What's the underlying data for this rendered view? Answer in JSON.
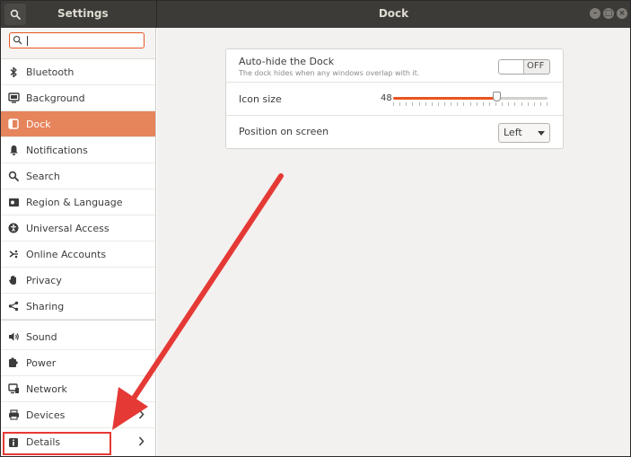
{
  "header": {
    "left_title": "Settings",
    "title": "Dock"
  },
  "search": {
    "value": "",
    "placeholder": ""
  },
  "sidebar": {
    "items": [
      {
        "label": "Bluetooth",
        "icon": "bluetooth-icon"
      },
      {
        "label": "Background",
        "icon": "display-icon"
      },
      {
        "label": "Dock",
        "icon": "dock-icon",
        "active": true
      },
      {
        "label": "Notifications",
        "icon": "bell-icon"
      },
      {
        "label": "Search",
        "icon": "search-icon"
      },
      {
        "label": "Region & Language",
        "icon": "flag-icon"
      },
      {
        "label": "Universal Access",
        "icon": "accessibility-icon"
      },
      {
        "label": "Online Accounts",
        "icon": "online-accounts-icon"
      },
      {
        "label": "Privacy",
        "icon": "hand-icon"
      },
      {
        "label": "Sharing",
        "icon": "share-icon"
      },
      {
        "label": "Sound",
        "icon": "speaker-icon"
      },
      {
        "label": "Power",
        "icon": "battery-icon"
      },
      {
        "label": "Network",
        "icon": "network-icon"
      },
      {
        "label": "Devices",
        "icon": "printer-icon",
        "has_submenu": true
      },
      {
        "label": "Details",
        "icon": "info-icon",
        "has_submenu": true,
        "highlighted": true
      }
    ]
  },
  "dock": {
    "autohide": {
      "label": "Auto-hide the Dock",
      "description": "The dock hides when any windows overlap with it.",
      "state": "OFF"
    },
    "icon_size": {
      "label": "Icon size",
      "value": "48",
      "min": 16,
      "max": 64
    },
    "position": {
      "label": "Position on screen",
      "selected": "Left"
    }
  },
  "colors": {
    "accent": "#e95420",
    "sidebar_active": "#e6845c",
    "headerbar": "#3c3b37",
    "annotation": "#e53935"
  }
}
